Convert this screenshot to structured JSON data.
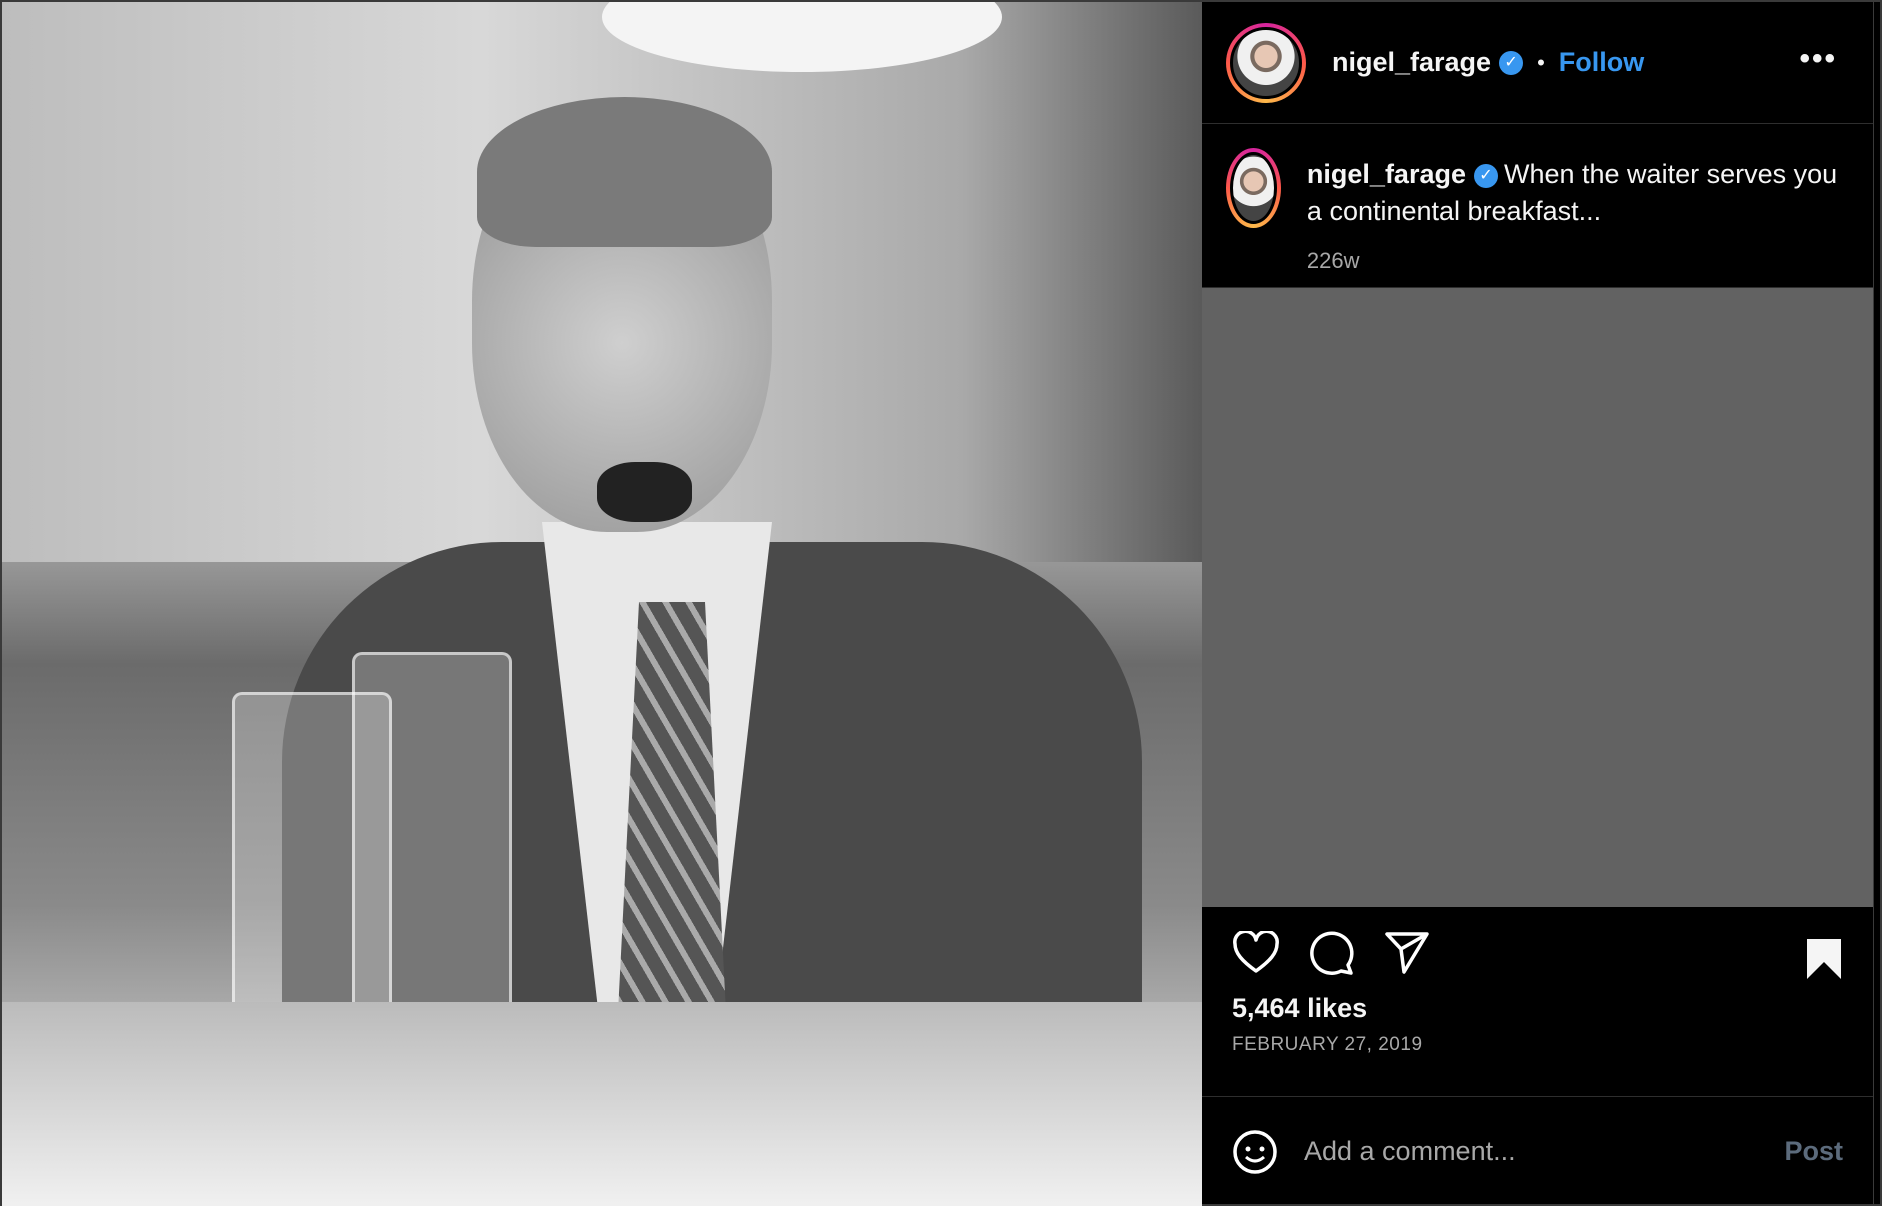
{
  "post": {
    "username": "nigel_farage",
    "follow_label": "Follow",
    "separator": "•",
    "more_label": "•••",
    "caption": "When the waiter serves you a continental breakfast...",
    "age": "226w",
    "likes": "5,464 likes",
    "date": "FEBRUARY 27, 2019",
    "comment_placeholder": "Add a comment...",
    "post_label": "Post",
    "saved": true
  },
  "colors": {
    "accent": "#3897f0",
    "post_disabled": "#5c6b7c",
    "panel_gray": "#626262"
  },
  "icons": [
    "verified-badge-icon",
    "more-options-icon",
    "heart-icon",
    "comment-icon",
    "share-icon",
    "bookmark-icon",
    "emoji-icon"
  ]
}
